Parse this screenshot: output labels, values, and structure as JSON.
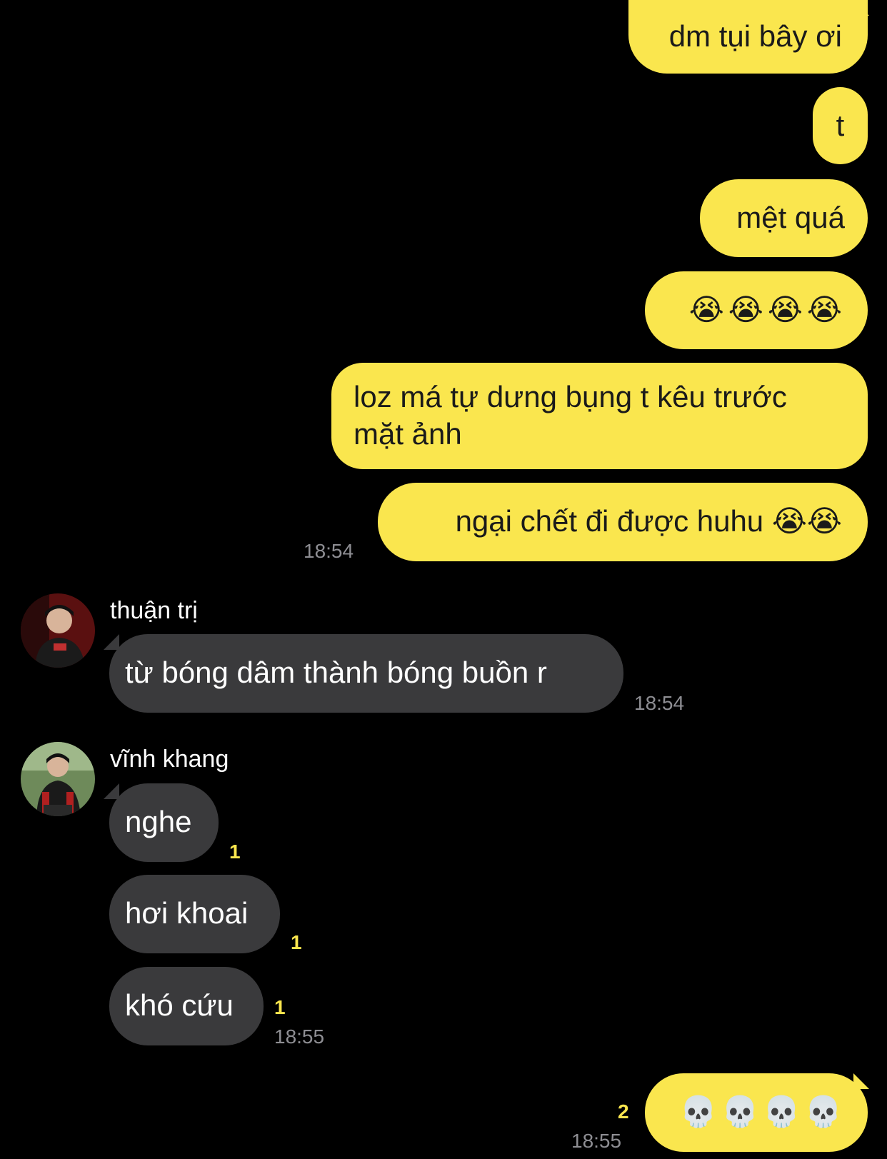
{
  "messages": [
    {
      "text": "dm tụi bây ơi"
    },
    {
      "text": "t"
    },
    {
      "text": "mệt quá"
    },
    {
      "text": "😭😭😭😭"
    },
    {
      "text": "loz má tự dưng bụng t kêu trước mặt ảnh"
    },
    {
      "text": "ngại chết đi được huhu 😭😭"
    },
    {
      "time": "18:54"
    },
    {
      "sender": "thuận trị",
      "avatar_icon": "user-avatar-icon"
    },
    {
      "text": "từ bóng dâm thành bóng buồn r",
      "time": "18:54"
    },
    {
      "sender": "vĩnh khang",
      "avatar_icon": "user-avatar-icon"
    },
    {
      "text": "nghe",
      "unread": "1"
    },
    {
      "text": "hơi khoai",
      "unread": "1"
    },
    {
      "text": "khó cứu",
      "unread": "1",
      "time": "18:55"
    },
    {
      "text": "💀💀💀💀",
      "unread": "2",
      "time": "18:55"
    }
  ],
  "colors": {
    "background": "#000000",
    "my_bubble": "#FAE64E",
    "their_bubble": "#3A3A3C",
    "unread_count": "#FAE64E",
    "timestamp": "#8E8E93"
  }
}
